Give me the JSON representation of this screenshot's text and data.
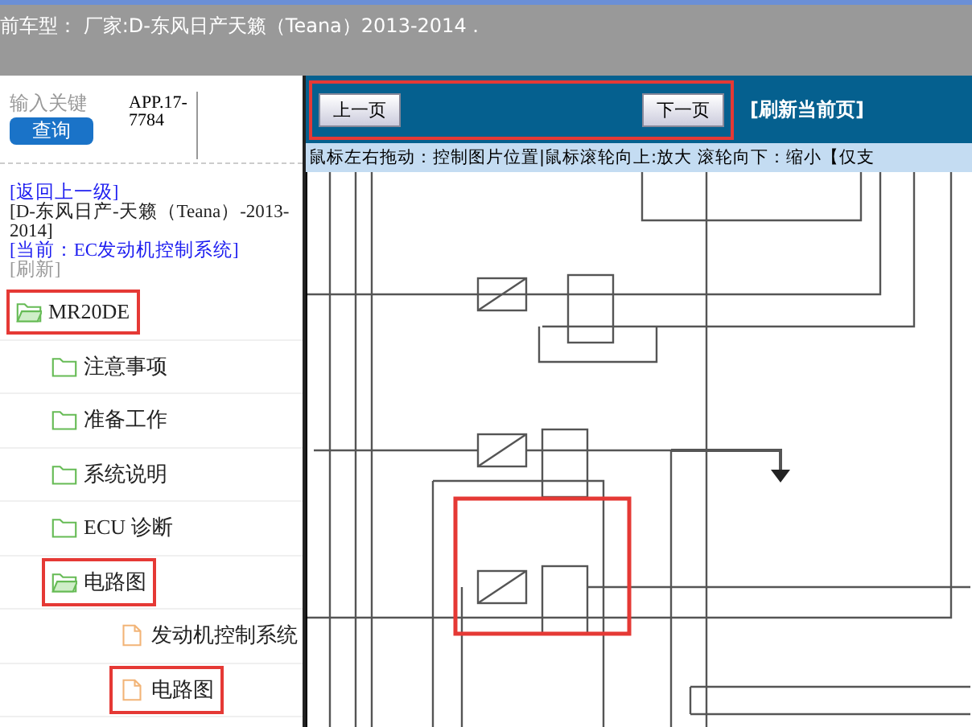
{
  "header": {
    "title": "前车型： 厂家:D-东风日产天籁（Teana）2013-2014 ."
  },
  "search": {
    "placeholder": "输入关键",
    "button": "查询",
    "app_code": "APP.17-7784"
  },
  "breadcrumb": {
    "back": "[返回上一级]",
    "path": "[D-东风日产-天籁（Teana）-2013-2014]",
    "current": "[当前：EC发动机控制系统]",
    "refresh": "[刷新]"
  },
  "tree": [
    {
      "label": "MR20DE",
      "kind": "folder",
      "expanded": true,
      "highlighted": true,
      "children": [
        {
          "label": "注意事项",
          "kind": "folder",
          "expanded": false,
          "highlighted": false
        },
        {
          "label": "准备工作",
          "kind": "folder",
          "expanded": false,
          "highlighted": false
        },
        {
          "label": "系统说明",
          "kind": "folder",
          "expanded": false,
          "highlighted": false
        },
        {
          "label": "ECU 诊断",
          "kind": "folder",
          "expanded": false,
          "highlighted": false
        },
        {
          "label": "电路图",
          "kind": "folder",
          "expanded": true,
          "highlighted": true,
          "children": [
            {
              "label": "发动机控制系统",
              "kind": "file",
              "highlighted": false
            },
            {
              "label": "电路图",
              "kind": "file",
              "highlighted": true
            }
          ]
        }
      ]
    }
  ],
  "nav": {
    "prev": "上一页",
    "next": "下一页",
    "refresh": "[刷新当前页]",
    "highlighted": true
  },
  "hint": "鼠标左右拖动：控制图片位置|鼠标滚轮向上:放大  滚轮向下：缩小【仅支",
  "diagram": {
    "highlighted": true
  }
}
